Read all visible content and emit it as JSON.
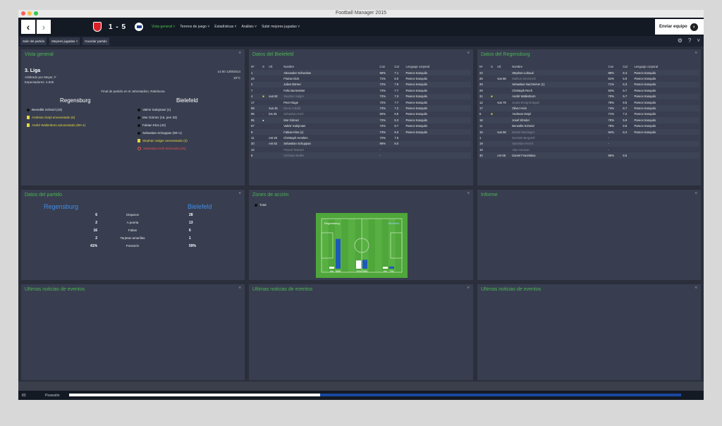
{
  "window": {
    "title": "Football Manager 2015"
  },
  "header": {
    "score": "1 - 5",
    "menu": [
      {
        "label": "Vista general ˅",
        "active": true
      },
      {
        "label": "Terreno de juego ˅",
        "active": false
      },
      {
        "label": "Estadísticas ˅",
        "active": false
      },
      {
        "label": "Análisis ˅",
        "active": false
      },
      {
        "label": "Subir mejores jugadas ˅",
        "active": false
      }
    ],
    "send_team": "Enviar equipo"
  },
  "subbar": {
    "exit": "Salir del partido",
    "highlights": "Mejores jugadas",
    "save": "Guardar partido"
  },
  "overview": {
    "title": "Vista general",
    "league": "3. Liga",
    "datetime": "14:00 13/9/2014",
    "referee": "Arbitrado por Meyer, F",
    "temperature": "18°C",
    "spectators": "Espectadores: 4.845",
    "final": "Final de partido en el Jahnstadion, Ratisbona",
    "home_team": "Regensburg",
    "away_team": "Bielefeld",
    "home_events": [
      {
        "text": "Benedikt Schmid (18)",
        "type": "goal"
      },
      {
        "text": "Andreas Geipl amonestado (6)",
        "type": "yellow"
      },
      {
        "text": "André Wallenborn amonestado (90+1)",
        "type": "yellow"
      }
    ],
    "away_events": [
      {
        "text": "Valmir Sulejmani (1)",
        "type": "goal"
      },
      {
        "text": "Mor Gómez (16, pen 33)",
        "type": "goal"
      },
      {
        "text": "Fabian Klos (42)",
        "type": "goal"
      },
      {
        "text": "Sebastian Schuppan (90+1)",
        "type": "goal"
      },
      {
        "text": "Stephan Salger amonestado (3)",
        "type": "yellow"
      },
      {
        "text": "Sebastian Kerk lesionado (25)",
        "type": "injury"
      }
    ]
  },
  "bielefeld": {
    "title": "Datos del Bielefeld",
    "headers": [
      "Nº",
      "S",
      "Inf.",
      "Nombre",
      "Con",
      "Cal",
      "Lenguaje corporal"
    ],
    "rows": [
      [
        "1",
        "",
        "",
        "Alexander Schwolow",
        "90%",
        "7.1",
        "Parece tranquilo"
      ],
      [
        "23",
        "",
        "",
        "Florian Dick",
        "71%",
        "6.0",
        "Parece tranquilo"
      ],
      [
        "2",
        "",
        "",
        "Julian Börner",
        "72%",
        "7.8",
        "Parece tranquilo"
      ],
      [
        "7",
        "",
        "",
        "Felix Burmeister",
        "72%",
        "7.7",
        "Parece tranquilo"
      ],
      [
        "4",
        "■",
        "sus 82",
        "Stephan Salger",
        "72%",
        "7.3",
        "Parece tranquilo"
      ],
      [
        "17",
        "",
        "",
        "Peer Kluge",
        "72%",
        "7.7",
        "Parece tranquilo"
      ],
      [
        "99",
        "",
        "sus 45",
        "Denis Colalić",
        "73%",
        "7.2",
        "Parece tranquilo"
      ],
      [
        "96",
        "○",
        "les 25",
        "Sebastian Kerk",
        "82%",
        "6.8",
        "Parece tranquilo"
      ],
      [
        "95",
        "●",
        "",
        "Mor Gómez",
        "72%",
        "9.3",
        "Parece tranquilo"
      ],
      [
        "97",
        "",
        "",
        "Valmir Sulejmani",
        "72%",
        "8.7",
        "Parece tranquilo"
      ],
      [
        "9",
        "",
        "",
        "Fabian Klos (c)",
        "73%",
        "9.0",
        "Parece tranquilo"
      ],
      [
        "11",
        "",
        "ent 25",
        "Christoph Hemlein",
        "72%",
        "7.5",
        ""
      ],
      [
        "20",
        "",
        "ent 82",
        "Sebastian Schuppan",
        "96%",
        "8.0",
        ""
      ],
      [
        "10",
        "",
        "",
        "Pascal Testroet",
        "-",
        "",
        ""
      ],
      [
        "8",
        "",
        "",
        "Christian Müller",
        "-",
        "",
        ""
      ]
    ]
  },
  "regensburg": {
    "title": "Datos del Regensburg",
    "headers": [
      "Nº",
      "S",
      "Inf.",
      "Nombre",
      "Con",
      "Cal",
      "Lenguaje corporal"
    ],
    "rows": [
      [
        "22",
        "",
        "",
        "Stephan Loboué",
        "88%",
        "6.4",
        "Parece tranquilo"
      ],
      [
        "25",
        "",
        "sus 66",
        "Markus Smarzoch",
        "81%",
        "5.9",
        "Parece tranquilo"
      ],
      [
        "28",
        "",
        "",
        "Sebastian Nachreiner (c)",
        "71%",
        "6.3",
        "Parece tranquilo"
      ],
      [
        "29",
        "",
        "",
        "Christoph Rech",
        "63%",
        "5.7",
        "Parece tranquilo"
      ],
      [
        "31",
        "■",
        "",
        "André Wallenborn",
        "70%",
        "5.7",
        "Parece tranquilo"
      ],
      [
        "12",
        "",
        "sus 79",
        "Jonas Erwig-Drüppel",
        "78%",
        "6.6",
        "Parece tranquilo"
      ],
      [
        "17",
        "",
        "",
        "Oliver Hein",
        "74%",
        "6.7",
        "Parece tranquilo"
      ],
      [
        "6",
        "■",
        "",
        "Andreas Geipl",
        "71%",
        "7.2",
        "Parece tranquilo"
      ],
      [
        "18",
        "",
        "",
        "Josef Sfordel",
        "70%",
        "5.9",
        "Parece tranquilo"
      ],
      [
        "11",
        "",
        "",
        "Benedikt Schmid",
        "78%",
        "6.8",
        "Parece tranquilo"
      ],
      [
        "15",
        "",
        "sus 56",
        "Daniel Steininger",
        "84%",
        "6.2",
        "Parece tranquilo"
      ],
      [
        "1",
        "",
        "",
        "Dominik Bergdorf",
        "-",
        "",
        ""
      ],
      [
        "19",
        "",
        "",
        "Stanislav Herzel",
        "-",
        "",
        ""
      ],
      [
        "10",
        "",
        "",
        "Alan Aseman",
        "-",
        "",
        ""
      ],
      [
        "30",
        "",
        "ent 56",
        "Daniel Franziskus",
        "86%",
        "6.5",
        ""
      ]
    ]
  },
  "match_stats": {
    "title": "Datos del partido",
    "home": "Regensburg",
    "away": "Bielefeld",
    "rows": [
      {
        "home": "6",
        "label": "Disparos",
        "away": "28"
      },
      {
        "home": "2",
        "label": "A puerta",
        "away": "13"
      },
      {
        "home": "16",
        "label": "Faltas",
        "away": "6"
      },
      {
        "home": "2",
        "label": "Tarjetas amarillas",
        "away": "1"
      },
      {
        "home": "41%",
        "label": "Posesión",
        "away": "59%"
      }
    ]
  },
  "zones": {
    "title": "Zones de acción",
    "toggle": "Total",
    "home": "Regensburg",
    "away": "Bielefeld",
    "thirds": [
      {
        "home": 6,
        "away": 94,
        "home_label": "6%",
        "away_label": "94%"
      },
      {
        "home": 26,
        "away": 28,
        "home_label": "26%",
        "away_label": "28%"
      },
      {
        "home": 6,
        "away": 7,
        "home_label": "6%",
        "away_label": "7%"
      }
    ]
  },
  "report": {
    "title": "Informe"
  },
  "news": [
    {
      "title": "Ultimas noticias de eventos"
    },
    {
      "title": "Ultimas noticias de eventos"
    },
    {
      "title": "Ultimas noticias de eventos"
    }
  ],
  "status": {
    "minute": "83",
    "label": "Posesión",
    "home_possession": 41
  }
}
